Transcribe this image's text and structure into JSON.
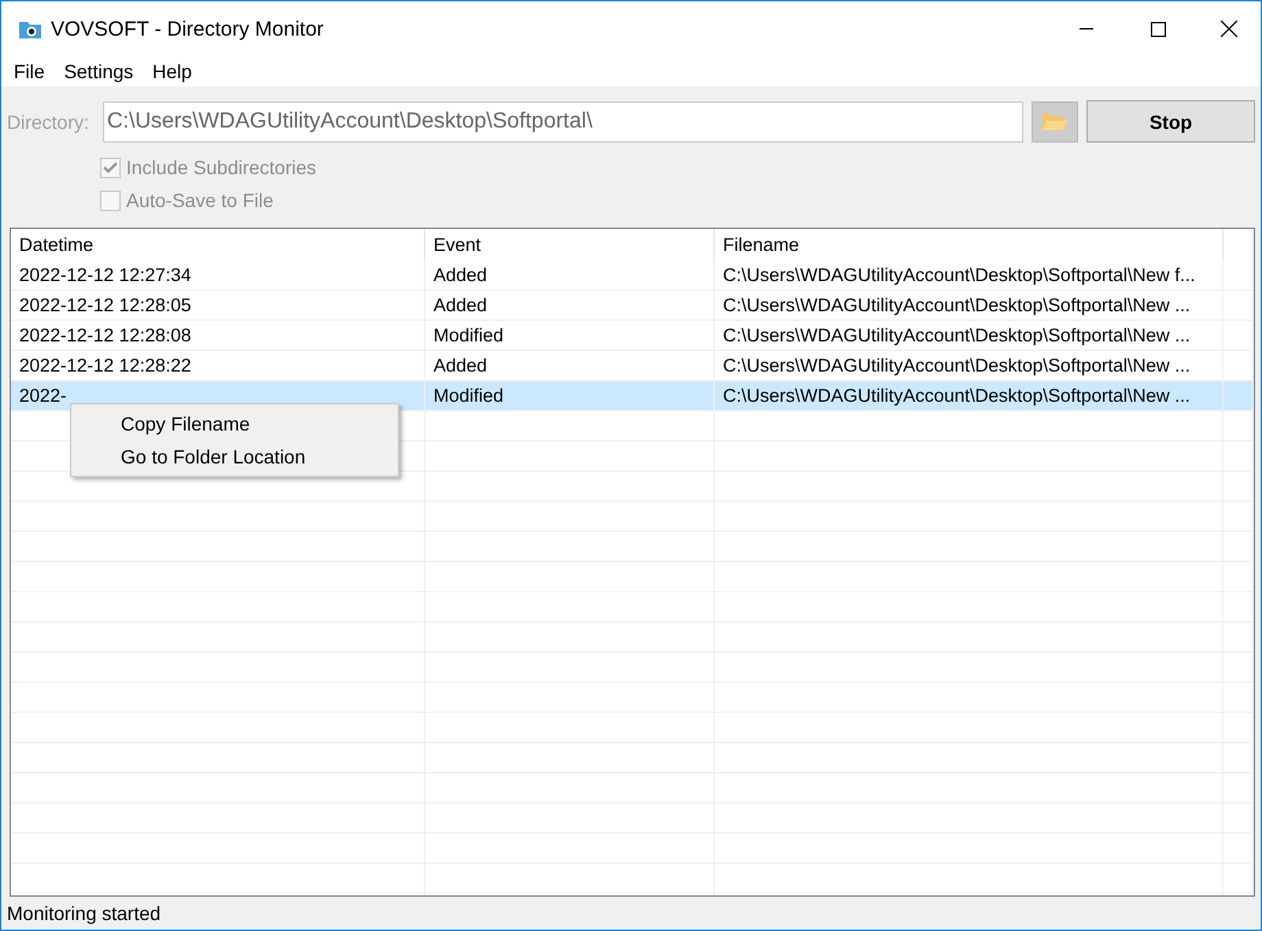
{
  "window": {
    "title": "VOVSOFT - Directory Monitor"
  },
  "menu": [
    "File",
    "Settings",
    "Help"
  ],
  "directory": {
    "label": "Directory:",
    "value": "C:\\Users\\WDAGUtilityAccount\\Desktop\\Softportal\\",
    "disabled": true
  },
  "stop_button": "Stop",
  "options": [
    {
      "label": "Include Subdirectories",
      "checked": true,
      "disabled": true
    },
    {
      "label": "Auto-Save to File",
      "checked": false,
      "disabled": true
    }
  ],
  "table": {
    "columns": [
      "Datetime",
      "Event",
      "Filename"
    ],
    "rows": [
      {
        "cells": [
          "2022-12-12 12:27:34",
          "Added",
          "C:\\Users\\WDAGUtilityAccount\\Desktop\\Softportal\\New f..."
        ],
        "selected": false
      },
      {
        "cells": [
          "2022-12-12 12:28:05",
          "Added",
          "C:\\Users\\WDAGUtilityAccount\\Desktop\\Softportal\\New ..."
        ],
        "selected": false
      },
      {
        "cells": [
          "2022-12-12 12:28:08",
          "Modified",
          "C:\\Users\\WDAGUtilityAccount\\Desktop\\Softportal\\New ..."
        ],
        "selected": false
      },
      {
        "cells": [
          "2022-12-12 12:28:22",
          "Added",
          "C:\\Users\\WDAGUtilityAccount\\Desktop\\Softportal\\New ..."
        ],
        "selected": false
      },
      {
        "cells": [
          "2022-",
          "Modified",
          "C:\\Users\\WDAGUtilityAccount\\Desktop\\Softportal\\New ..."
        ],
        "selected": true
      }
    ]
  },
  "context_menu": [
    "Copy Filename",
    "Go to Folder Location"
  ],
  "status_bar": "Monitoring started"
}
